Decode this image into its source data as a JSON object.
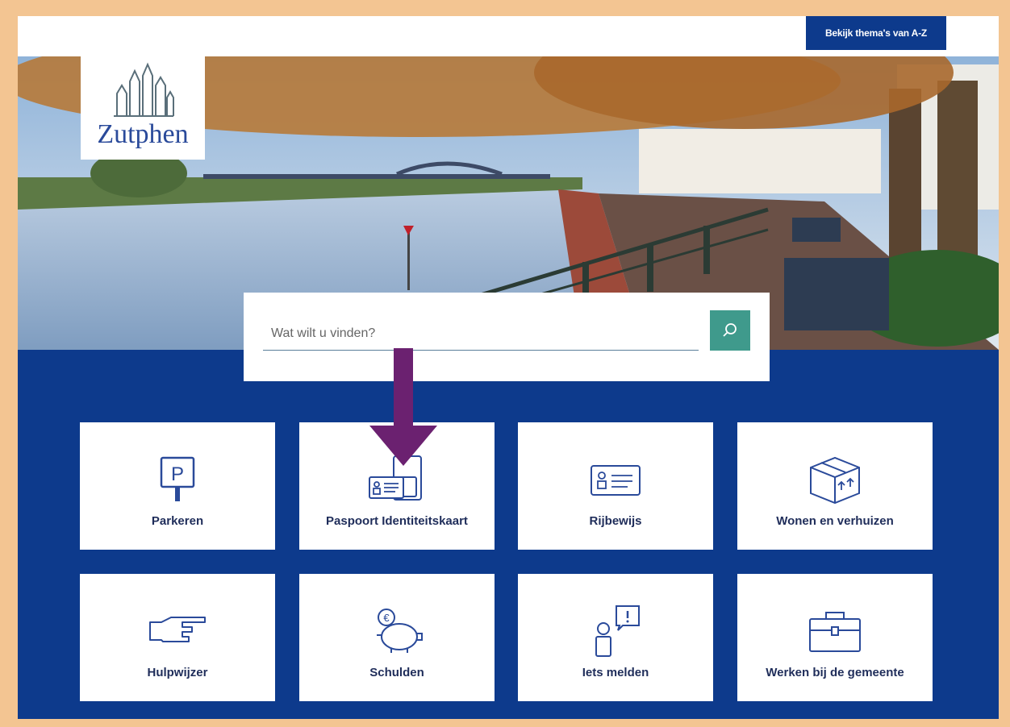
{
  "header": {
    "logo_text": "Zutphen",
    "az_button": "Bekijk thema's van A-Z"
  },
  "search": {
    "placeholder": "Wat wilt u vinden?",
    "button_icon": "search-icon"
  },
  "tiles": [
    {
      "label": "Parkeren",
      "icon": "parking-sign-icon"
    },
    {
      "label": "Paspoort Identiteitskaart",
      "icon": "id-documents-icon"
    },
    {
      "label": "Rijbewijs",
      "icon": "id-card-icon"
    },
    {
      "label": "Wonen en verhuizen",
      "icon": "moving-box-icon"
    },
    {
      "label": "Hulpwijzer",
      "icon": "pointing-hand-icon"
    },
    {
      "label": "Schulden",
      "icon": "piggy-bank-icon"
    },
    {
      "label": "Iets melden",
      "icon": "person-report-icon"
    },
    {
      "label": "Werken bij de gemeente",
      "icon": "briefcase-icon"
    }
  ],
  "colors": {
    "brand_blue": "#0d3a8c",
    "search_green": "#3f9a8c",
    "annotation_purple": "#6b2170",
    "frame": "#f3c592"
  }
}
